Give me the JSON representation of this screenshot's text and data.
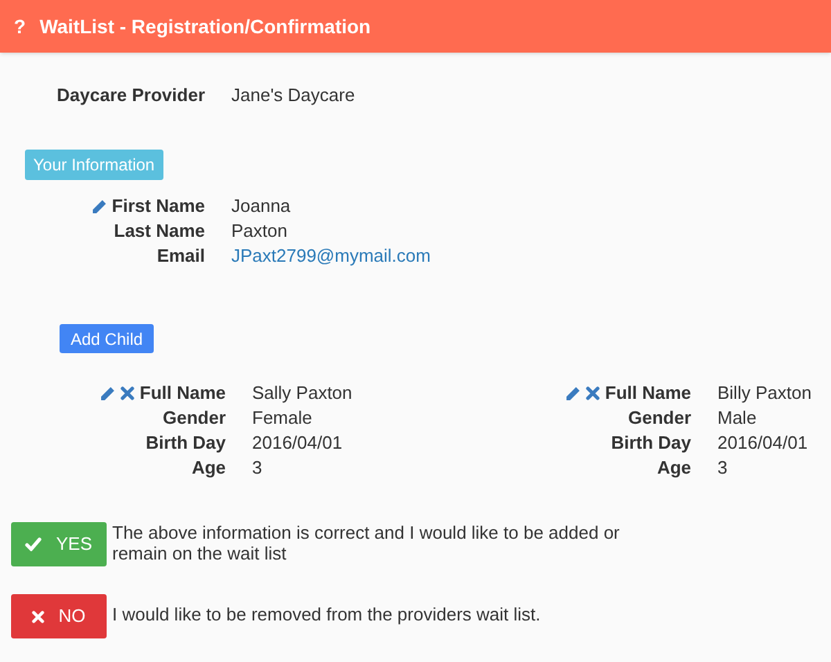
{
  "header": {
    "icon": "?",
    "title": "WaitList - Registration/Confirmation"
  },
  "provider": {
    "label": "Daycare Provider",
    "value": "Jane's Daycare"
  },
  "your_information": {
    "badge": "Your Information",
    "fields": [
      {
        "label": "First Name",
        "value": "Joanna",
        "editable": true,
        "kind": "text"
      },
      {
        "label": "Last Name",
        "value": "Paxton",
        "editable": false,
        "kind": "text"
      },
      {
        "label": "Email",
        "value": "JPaxt2799@mymail.com",
        "editable": false,
        "kind": "link"
      }
    ]
  },
  "add_child_button": "Add Child",
  "children": [
    {
      "fields": [
        {
          "label": "Full Name",
          "value": "Sally Paxton"
        },
        {
          "label": "Gender",
          "value": "Female"
        },
        {
          "label": "Birth Day",
          "value": "2016/04/01"
        },
        {
          "label": "Age",
          "value": "3"
        }
      ]
    },
    {
      "fields": [
        {
          "label": "Full Name",
          "value": "Billy Paxton"
        },
        {
          "label": "Gender",
          "value": "Male"
        },
        {
          "label": "Birth Day",
          "value": "2016/04/01"
        },
        {
          "label": "Age",
          "value": "3"
        }
      ]
    }
  ],
  "actions": [
    {
      "kind": "yes",
      "button": "YES",
      "text": "The above information is correct and I would like to be added or remain on the wait list"
    },
    {
      "kind": "no",
      "button": "NO",
      "text": "I would like to be removed from the providers wait list."
    }
  ]
}
